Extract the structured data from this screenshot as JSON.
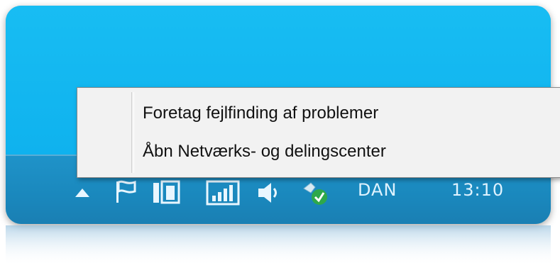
{
  "context_menu": {
    "items": [
      {
        "label": "Foretag fejlfinding af problemer"
      },
      {
        "label": "Åbn Netværks- og delingscenter"
      }
    ]
  },
  "tray": {
    "icons": [
      "show-hidden-icons-arrow-icon",
      "action-center-flag-icon",
      "power-battery-icon",
      "network-signal-icon",
      "volume-icon",
      "windows-update-shield-icon"
    ],
    "language": "DAN",
    "clock": "13:10"
  },
  "colors": {
    "desktop": "#12b5ef",
    "taskbar": "#1a88bd",
    "menu_background": "#f2f2f2"
  }
}
